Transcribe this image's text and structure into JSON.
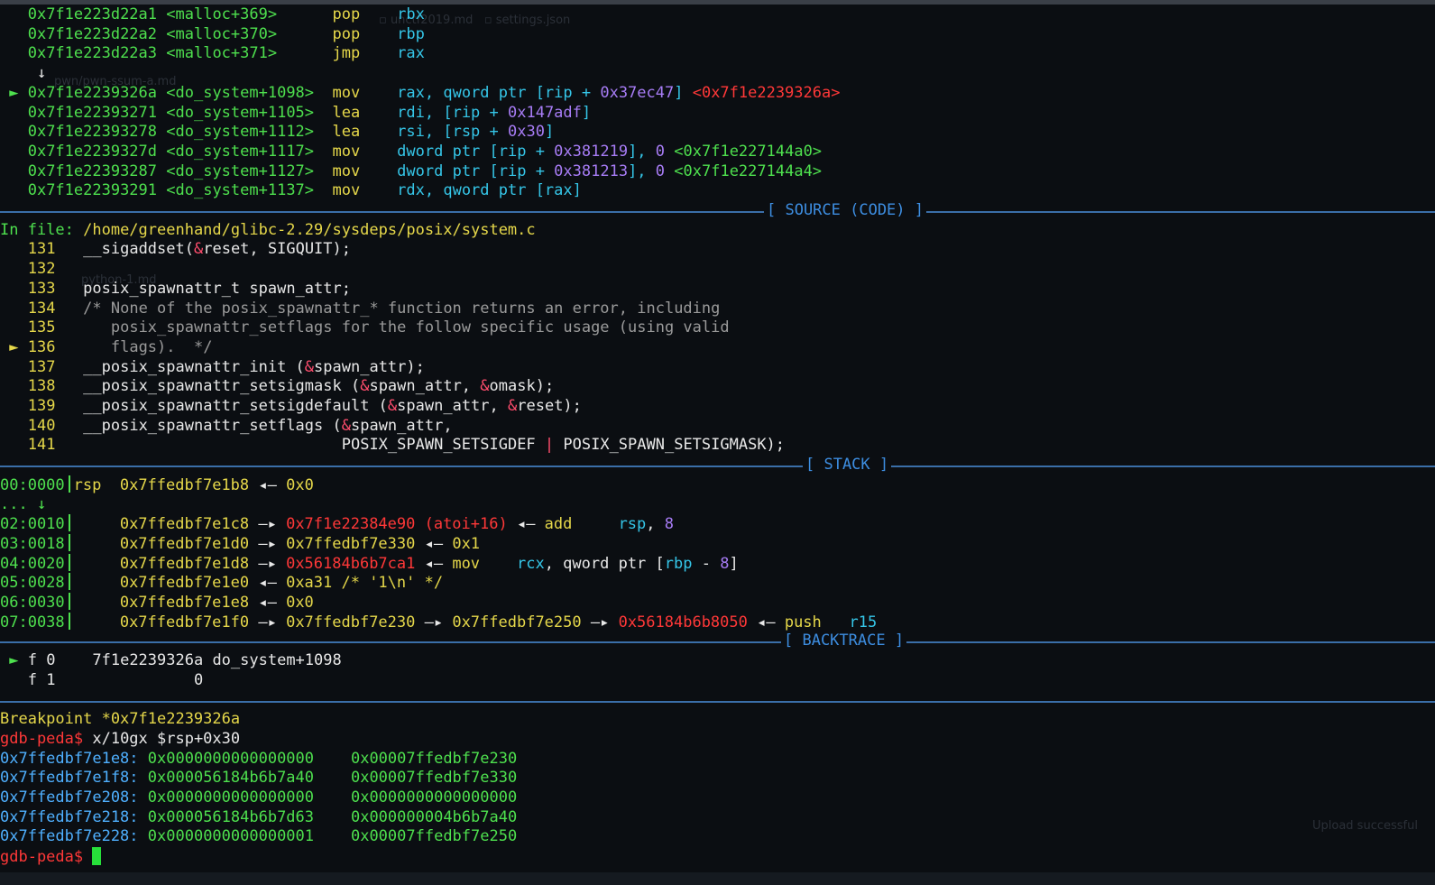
{
  "code": [
    {
      "marker": " ",
      "addr": "0x7f1e223d22a1",
      "sym": "<malloc+369>",
      "mnem": "pop",
      "ops": [
        [
          "w",
          "rbx"
        ]
      ]
    },
    {
      "marker": " ",
      "addr": "0x7f1e223d22a2",
      "sym": "<malloc+370>",
      "mnem": "pop",
      "ops": [
        [
          "w",
          "rbp"
        ]
      ]
    },
    {
      "marker": " ",
      "addr": "0x7f1e223d22a3",
      "sym": "<malloc+371>",
      "mnem": "jmp",
      "ops": [
        [
          "w",
          "rax"
        ]
      ]
    },
    {
      "marker": "arrow",
      "text": "↓"
    },
    {
      "marker": "►",
      "addr": "0x7f1e2239326a",
      "sym": "<do_system+1098>",
      "mnem": "mov",
      "ops": [
        [
          "w",
          "rax, qword ptr [rip + "
        ],
        [
          "m",
          "0x37ec47"
        ],
        [
          "w",
          "] "
        ],
        [
          "r",
          "<0x7f1e2239326a>"
        ]
      ]
    },
    {
      "marker": " ",
      "addr": "0x7f1e22393271",
      "sym": "<do_system+1105>",
      "mnem": "lea",
      "ops": [
        [
          "w",
          "rdi, [rip + "
        ],
        [
          "m",
          "0x147adf"
        ],
        [
          "w",
          "]"
        ]
      ]
    },
    {
      "marker": " ",
      "addr": "0x7f1e22393278",
      "sym": "<do_system+1112>",
      "mnem": "lea",
      "ops": [
        [
          "w",
          "rsi, [rsp + "
        ],
        [
          "m",
          "0x30"
        ],
        [
          "w",
          "]"
        ]
      ]
    },
    {
      "marker": " ",
      "addr": "0x7f1e2239327d",
      "sym": "<do_system+1117>",
      "mnem": "mov",
      "ops": [
        [
          "w",
          "dword ptr [rip + "
        ],
        [
          "m",
          "0x381219"
        ],
        [
          "w",
          "], "
        ],
        [
          "m",
          "0"
        ],
        [
          "w",
          " "
        ],
        [
          "g",
          "<0x7f1e227144a0>"
        ]
      ]
    },
    {
      "marker": " ",
      "addr": "0x7f1e22393287",
      "sym": "<do_system+1127>",
      "mnem": "mov",
      "ops": [
        [
          "w",
          "dword ptr [rip + "
        ],
        [
          "m",
          "0x381213"
        ],
        [
          "w",
          "], "
        ],
        [
          "m",
          "0"
        ],
        [
          "w",
          " "
        ],
        [
          "g",
          "<0x7f1e227144a4>"
        ]
      ]
    },
    {
      "marker": " ",
      "addr": "0x7f1e22393291",
      "sym": "<do_system+1137>",
      "mnem": "mov",
      "ops": [
        [
          "w",
          "rdx, qword ptr [rax]"
        ]
      ]
    }
  ],
  "sections": {
    "source": "[ SOURCE (CODE) ]",
    "stack": "[ STACK ]",
    "backtrace": "[ BACKTRACE ]"
  },
  "source": {
    "file_label": "In file: ",
    "file_path": "/home/greenhand/glibc-2.29/sysdeps/posix/system.c",
    "lines": [
      {
        "marker": " ",
        "num": "131",
        "parts": [
          [
            "w",
            "  __sigaddset("
          ],
          [
            "amp",
            "&"
          ],
          [
            "w",
            "reset, SIGQUIT);"
          ]
        ]
      },
      {
        "marker": " ",
        "num": "132",
        "parts": [
          [
            "w",
            ""
          ]
        ]
      },
      {
        "marker": " ",
        "num": "133",
        "parts": [
          [
            "w",
            "  posix_spawnattr_t spawn_attr;"
          ]
        ]
      },
      {
        "marker": " ",
        "num": "134",
        "parts": [
          [
            "gr",
            "  /* None of the posix_spawnattr_* function returns an error, including"
          ]
        ]
      },
      {
        "marker": " ",
        "num": "135",
        "parts": [
          [
            "gr",
            "     posix_spawnattr_setflags for the follow specific usage (using valid"
          ]
        ]
      },
      {
        "marker": "►",
        "num": "136",
        "parts": [
          [
            "gr",
            "     flags).  */"
          ]
        ]
      },
      {
        "marker": " ",
        "num": "137",
        "parts": [
          [
            "w",
            "  __posix_spawnattr_init ("
          ],
          [
            "amp",
            "&"
          ],
          [
            "w",
            "spawn_attr);"
          ]
        ]
      },
      {
        "marker": " ",
        "num": "138",
        "parts": [
          [
            "w",
            "  __posix_spawnattr_setsigmask ("
          ],
          [
            "amp",
            "&"
          ],
          [
            "w",
            "spawn_attr, "
          ],
          [
            "amp",
            "&"
          ],
          [
            "w",
            "omask);"
          ]
        ]
      },
      {
        "marker": " ",
        "num": "139",
        "parts": [
          [
            "w",
            "  __posix_spawnattr_setsigdefault ("
          ],
          [
            "amp",
            "&"
          ],
          [
            "w",
            "spawn_attr, "
          ],
          [
            "amp",
            "&"
          ],
          [
            "w",
            "reset);"
          ]
        ]
      },
      {
        "marker": " ",
        "num": "140",
        "parts": [
          [
            "w",
            "  __posix_spawnattr_setflags ("
          ],
          [
            "amp",
            "&"
          ],
          [
            "w",
            "spawn_attr,"
          ]
        ]
      },
      {
        "marker": " ",
        "num": "141",
        "parts": [
          [
            "w",
            "                              POSIX_SPAWN_SETSIGDEF "
          ],
          [
            "amp",
            "|"
          ],
          [
            "w",
            " POSIX_SPAWN_SETSIGMASK);"
          ]
        ]
      }
    ]
  },
  "stack": [
    {
      "idx": "00:0000",
      "parts": [
        [
          "y",
          "rsp  "
        ],
        [
          "y",
          "0x7ffedbf7e1b8"
        ],
        [
          "w",
          " ◂— "
        ],
        [
          "y",
          "0x0"
        ]
      ]
    },
    {
      "idx": "... ↓",
      "noBar": true,
      "parts": []
    },
    {
      "idx": "02:0010",
      "parts": [
        [
          "y",
          "     0x7ffedbf7e1c8"
        ],
        [
          "w",
          " —▸ "
        ],
        [
          "r",
          "0x7f1e22384e90 (atoi+16)"
        ],
        [
          "w",
          " ◂— "
        ],
        [
          "y",
          "add     "
        ],
        [
          "c",
          "rsp"
        ],
        [
          "w",
          ", "
        ],
        [
          "m",
          "8"
        ]
      ]
    },
    {
      "idx": "03:0018",
      "parts": [
        [
          "y",
          "     0x7ffedbf7e1d0"
        ],
        [
          "w",
          " —▸ "
        ],
        [
          "y",
          "0x7ffedbf7e330"
        ],
        [
          "w",
          " ◂— "
        ],
        [
          "y",
          "0x1"
        ]
      ]
    },
    {
      "idx": "04:0020",
      "parts": [
        [
          "y",
          "     0x7ffedbf7e1d8"
        ],
        [
          "w",
          " —▸ "
        ],
        [
          "r",
          "0x56184b6b7ca1"
        ],
        [
          "w",
          " ◂— "
        ],
        [
          "y",
          "mov    "
        ],
        [
          "c",
          "rcx"
        ],
        [
          "w",
          ", qword ptr ["
        ],
        [
          "c",
          "rbp"
        ],
        [
          "w",
          " - "
        ],
        [
          "m",
          "8"
        ],
        [
          "w",
          "]"
        ]
      ]
    },
    {
      "idx": "05:0028",
      "parts": [
        [
          "y",
          "     0x7ffedbf7e1e0"
        ],
        [
          "w",
          " ◂— "
        ],
        [
          "y",
          "0xa31 /* '1\\n' */"
        ]
      ]
    },
    {
      "idx": "06:0030",
      "parts": [
        [
          "y",
          "     0x7ffedbf7e1e8"
        ],
        [
          "w",
          " ◂— "
        ],
        [
          "y",
          "0x0"
        ]
      ]
    },
    {
      "idx": "07:0038",
      "parts": [
        [
          "y",
          "     0x7ffedbf7e1f0"
        ],
        [
          "w",
          " —▸ "
        ],
        [
          "y",
          "0x7ffedbf7e230"
        ],
        [
          "w",
          " —▸ "
        ],
        [
          "y",
          "0x7ffedbf7e250"
        ],
        [
          "w",
          " —▸ "
        ],
        [
          "r",
          "0x56184b6b8050"
        ],
        [
          "w",
          " ◂— "
        ],
        [
          "y",
          "push   "
        ],
        [
          "c",
          "r15"
        ]
      ]
    }
  ],
  "backtrace": [
    {
      "marker": "►",
      "frame": "f 0",
      "addr": "    7f1e2239326a",
      "sym": " do_system+1098"
    },
    {
      "marker": " ",
      "frame": "f 1",
      "addr": "               0",
      "sym": ""
    }
  ],
  "console": {
    "breakpoint": "Breakpoint *0x7f1e2239326a",
    "prompt": "gdb-peda$",
    "command": " x/10gx $rsp+0x30",
    "rows": [
      {
        "addr": "0x7ffedbf7e1e8:",
        "v1": "0x0000000000000000",
        "v2": "0x00007ffedbf7e230"
      },
      {
        "addr": "0x7ffedbf7e1f8:",
        "v1": "0x000056184b6b7a40",
        "v2": "0x00007ffedbf7e330"
      },
      {
        "addr": "0x7ffedbf7e208:",
        "v1": "0x0000000000000000",
        "v2": "0x0000000000000000"
      },
      {
        "addr": "0x7ffedbf7e218:",
        "v1": "0x000056184b6b7d63",
        "v2": "0x000000004b6b7a40"
      },
      {
        "addr": "0x7ffedbf7e228:",
        "v1": "0x0000000000000001",
        "v2": "0x00007ffedbf7e250"
      }
    ]
  },
  "colors": {
    "background": "#0b0e12",
    "address": "#4ee04e",
    "mnemonic": "#e6d84a",
    "register": "#35c6e8",
    "number": "#a77cf5",
    "pointer": "#ff3838",
    "separator": "#3a6ea8",
    "section_title": "#3d8de0",
    "prompt": "#ff3838",
    "console_addr": "#4fb0ff"
  }
}
